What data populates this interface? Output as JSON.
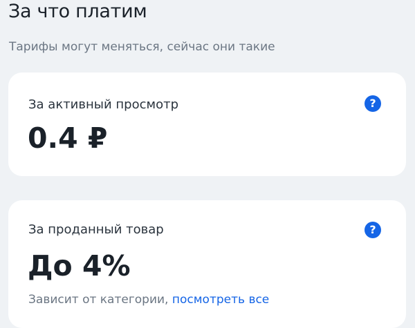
{
  "header": {
    "title": "За что платим",
    "subtitle": "Тарифы могут меняться, сейчас они такие"
  },
  "cards": [
    {
      "label": "За активный просмотр",
      "value": "0.4 ₽",
      "help_icon": "question-circle-icon",
      "help_glyph": "?"
    },
    {
      "label": "За проданный товар",
      "value": "До 4%",
      "help_icon": "question-circle-icon",
      "help_glyph": "?",
      "note_text": "Зависит от категории, ",
      "note_link": "посмотреть все"
    }
  ],
  "colors": {
    "background": "#eff2f5",
    "card": "#ffffff",
    "accent": "#1565e6",
    "text_primary": "#1a2129",
    "text_secondary": "#6b7683"
  }
}
